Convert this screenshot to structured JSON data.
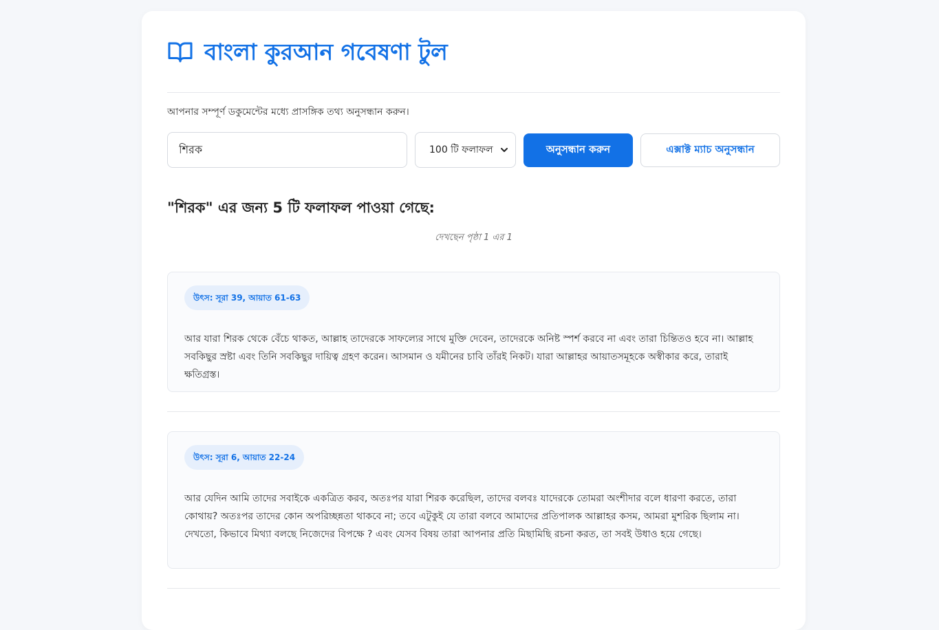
{
  "app": {
    "title": "বাংলা কুরআন গবেষণা টুল",
    "subtitle": "আপনার সম্পূর্ণ ডকুমেন্টের মধ্যে প্রাসঙ্গিক তথ্য অনুসন্ধান করুন।"
  },
  "search": {
    "query": "শিরক",
    "results_option": "100 টি ফলাফল",
    "search_button": "অনুসন্ধান করুন",
    "exact_match_button": "এক্সাক্ট ম্যাচ অনুসন্ধান"
  },
  "results": {
    "heading": "\"শিরক\" এর জন্য 5 টি ফলাফল পাওয়া গেছে:",
    "page_info": "দেখছেন পৃষ্ঠা 1 এর 1",
    "items": [
      {
        "source": "উৎস: সূরা 39, আয়াত 61-63",
        "text": "আর যারা শিরক থেকে বেঁচে থাকত, আল্লাহ তাদেরকে সাফল্যের সাথে মুক্তি দেবেন, তাদেরকে অনিষ্ট স্পর্শ করবে না এবং তারা চিন্তিতও হবে না। আল্লাহ সবকিছুর স্রষ্টা এবং তিনি সবকিছুর দায়িত্ব গ্রহণ করেন। আসমান ও যমীনের চাবি তাঁরই নিকট। যারা আল্লাহর আয়াতসমূহকে অস্বীকার করে, তারাই ক্ষতিগ্রস্ত।"
      },
      {
        "source": "উৎস: সূরা 6, আয়াত 22-24",
        "text": "আর যেদিন আমি তাদের সবাইকে একত্রিত করব, অতঃপর যারা শিরক করেছিল, তাদের বলবঃ যাদেরকে তোমরা অংশীদার বলে ধারণা করতে, তারা কোথায়? অতঃপর তাদের কোন অপরিচ্ছন্নতা থাকবে না; তবে এটুকুই যে তারা বলবে আমাদের প্রতিপালক আল্লাহর কসম, আমরা মুশরিক ছিলাম না। দেখতো, কিভাবে মিথ্যা বলছে নিজেদের বিপক্ষে ? এবং যেসব বিষয় তারা আপনার প্রতি মিছামিছি রচনা করত, তা সবই উধাও হয়ে গেছে।"
      }
    ]
  },
  "colors": {
    "accent": "#1271e6",
    "badge_bg": "#e6effc",
    "page_bg": "#f5f7fa"
  },
  "icons": {
    "title_icon": "open-book-icon",
    "select_icon": "chevron-down-icon"
  }
}
